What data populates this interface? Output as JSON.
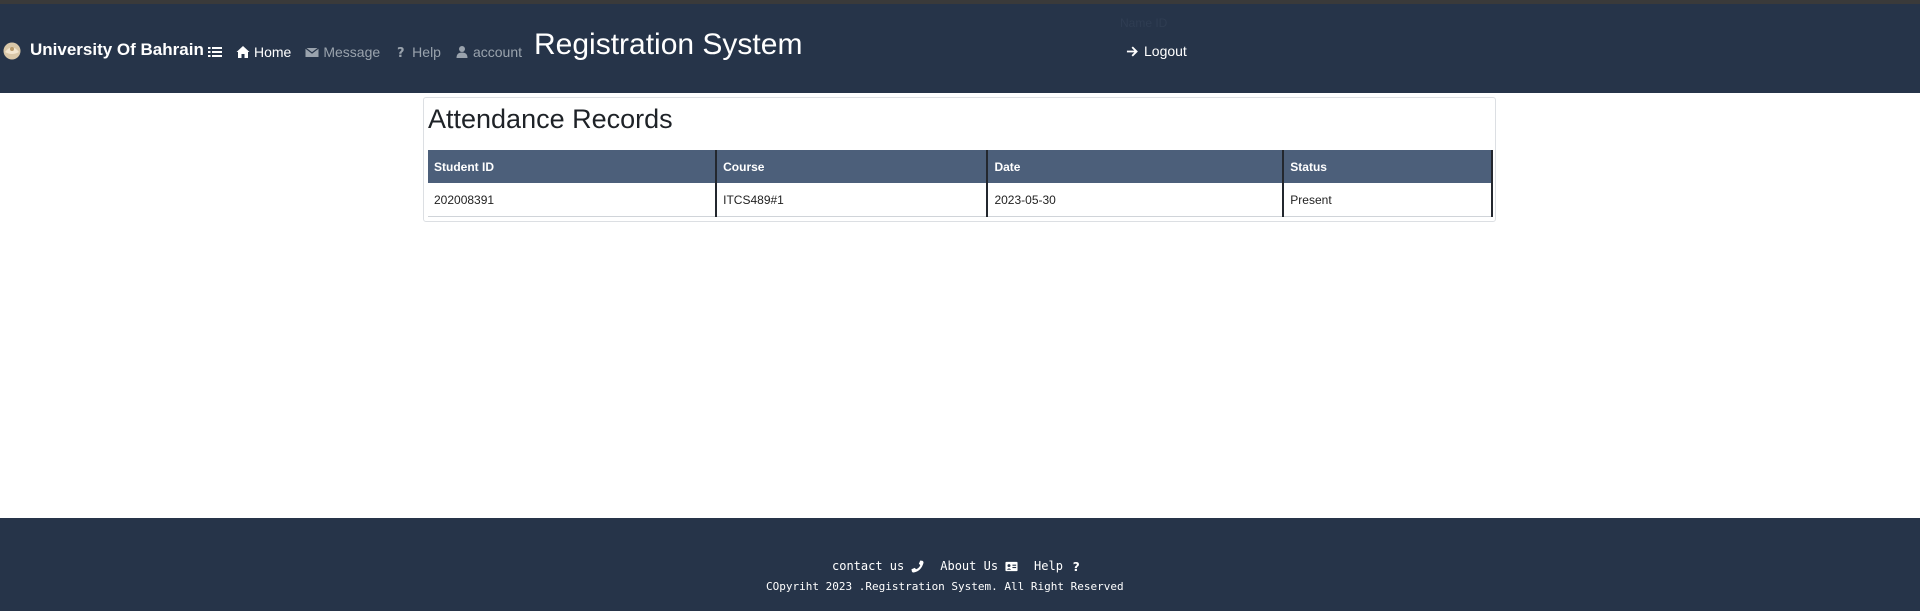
{
  "header": {
    "brand": "University Of Bahrain",
    "app_title": "Registration System",
    "user_info": "Name   ID",
    "nav": [
      {
        "label": "Home",
        "icon": "home-icon"
      },
      {
        "label": "Message",
        "icon": "envelope-icon"
      },
      {
        "label": "Help",
        "icon": "question-icon"
      },
      {
        "label": "account",
        "icon": "user-icon"
      }
    ],
    "logout_label": "Logout"
  },
  "main": {
    "title": "Attendance Records",
    "table": {
      "headers": [
        "Student ID",
        "Course",
        "Date",
        "Status"
      ],
      "rows": [
        [
          "202008391",
          "ITCS489#1",
          "2023-05-30",
          "Present"
        ]
      ]
    }
  },
  "footer": {
    "links": [
      {
        "label": "contact us",
        "icon": "phone-icon"
      },
      {
        "label": "About Us",
        "icon": "id-card-icon"
      },
      {
        "label": "Help",
        "icon": "question-icon"
      }
    ],
    "copyright": "COpyriht 2023 .Registration System. All Right Reserved"
  },
  "colors": {
    "navbar": "#263449",
    "table_header": "#4c5f7a",
    "accent_text": "#ffffff"
  }
}
